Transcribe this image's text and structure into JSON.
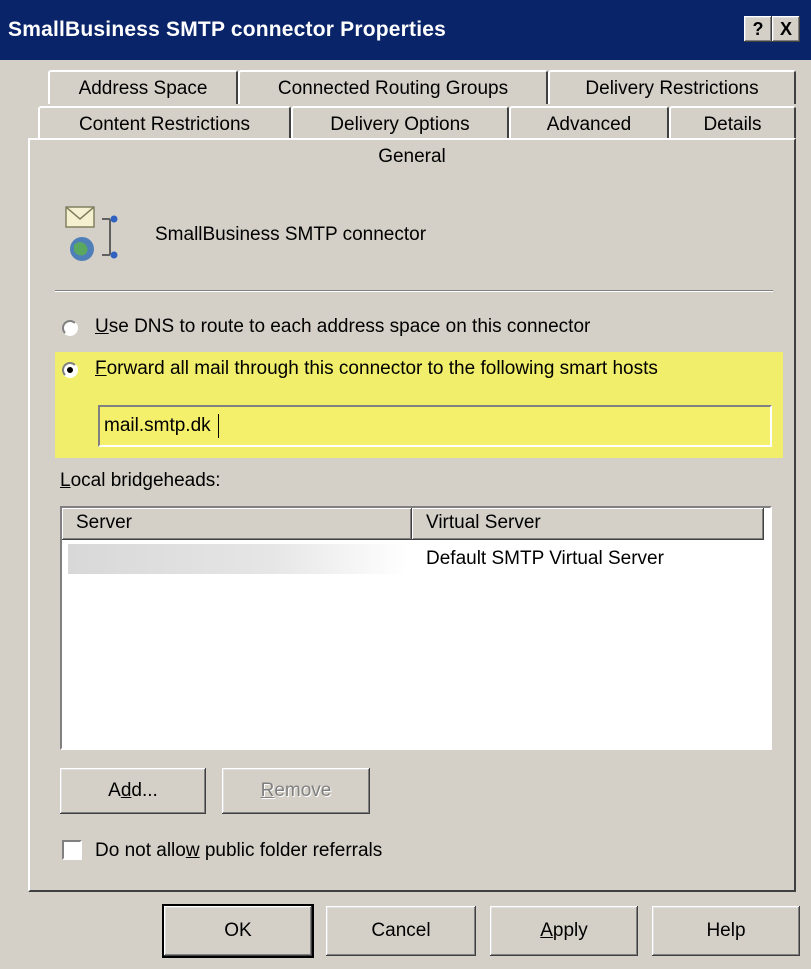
{
  "window": {
    "title": "SmallBusiness SMTP connector Properties",
    "help_button": "?",
    "close_button": "X"
  },
  "tabs": {
    "row1": [
      "Address Space",
      "Connected Routing Groups",
      "Delivery Restrictions"
    ],
    "row2": [
      "Content Restrictions",
      "Delivery Options",
      "Advanced",
      "Details"
    ],
    "row3": [
      "General"
    ]
  },
  "general": {
    "connector_name": "SmallBusiness SMTP connector",
    "icon": "smtp-connector-icon",
    "option_dns": "Use DNS to route to each address space on this connector",
    "option_forward": "Forward all mail through this connector to the following smart hosts",
    "selected_option": "forward",
    "smart_host": "mail.smtp.dk",
    "bridgeheads_label": "Local bridgeheads:",
    "columns": [
      "Server",
      "Virtual Server"
    ],
    "rows": [
      {
        "server": "",
        "virtual_server": "Default SMTP Virtual Server"
      }
    ],
    "add_button": "Add...",
    "remove_button": "Remove",
    "public_folder_label": "Do not allow public folder referrals",
    "public_folder_checked": false
  },
  "footer": {
    "ok": "OK",
    "cancel": "Cancel",
    "apply": "Apply",
    "help": "Help"
  },
  "colors": {
    "titlebar": "#0a246a",
    "dialog_bg": "#d4d0c8",
    "highlight": "#f0ee6a"
  }
}
